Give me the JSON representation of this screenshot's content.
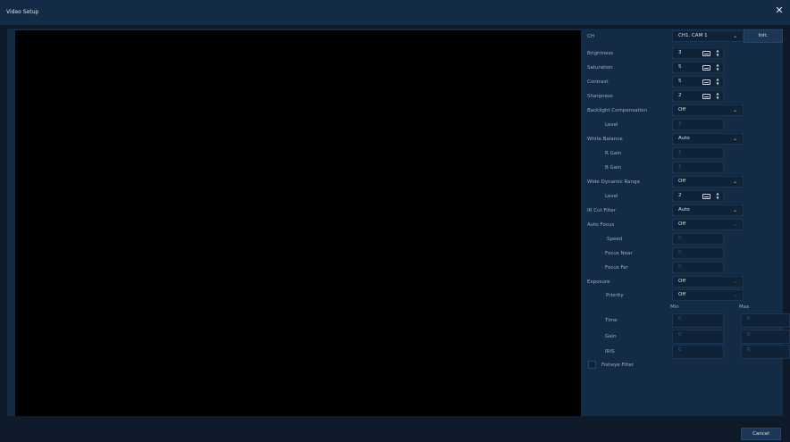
{
  "window": {
    "title": "Video Setup"
  },
  "channel": {
    "label": "CH",
    "value": "CH1. CAM 1",
    "init_label": "Init."
  },
  "settings": {
    "brightness": {
      "label": "Brightness",
      "value": "3"
    },
    "saturation": {
      "label": "Saturation",
      "value": "5"
    },
    "contrast": {
      "label": "Contrast",
      "value": "5"
    },
    "sharpness": {
      "label": "Sharpness",
      "value": "2"
    },
    "backlight": {
      "label": "Backlight Compensation",
      "value": "Off",
      "level_label": "Level",
      "level_value": "2"
    },
    "white_balance": {
      "label": "White Balance",
      "value": "Auto",
      "r_gain_label": "R Gain",
      "r_gain_value": "1",
      "b_gain_label": "B Gain",
      "b_gain_value": "1"
    },
    "wdr": {
      "label": "Wide Dynamic Range",
      "value": "Off",
      "level_label": "Level",
      "level_value": "2"
    },
    "ir_cut": {
      "label": "IR Cut Filter",
      "value": "Auto"
    },
    "auto_focus": {
      "label": "Auto Focus",
      "value": "Off",
      "speed_label": "Speed",
      "speed_value": "0",
      "focus_near_label": "Focus Near",
      "focus_near_value": "0",
      "focus_far_label": "Focus Far",
      "focus_far_value": "0"
    },
    "exposure": {
      "label": "Exposure",
      "value": "Off",
      "priority_label": "Priority",
      "priority_value": "Off",
      "min_label": "Min",
      "max_label": "Max",
      "time_label": "Time",
      "time_min": "0",
      "time_max": "0",
      "gain_label": "Gain",
      "gain_min": "0",
      "gain_max": "0",
      "iris_label": "IRIS",
      "iris_min": "0",
      "iris_max": "0"
    },
    "fisheye": {
      "label": "Fisheye Filter",
      "checked": false
    }
  },
  "footer": {
    "cancel_label": "Cancel"
  }
}
